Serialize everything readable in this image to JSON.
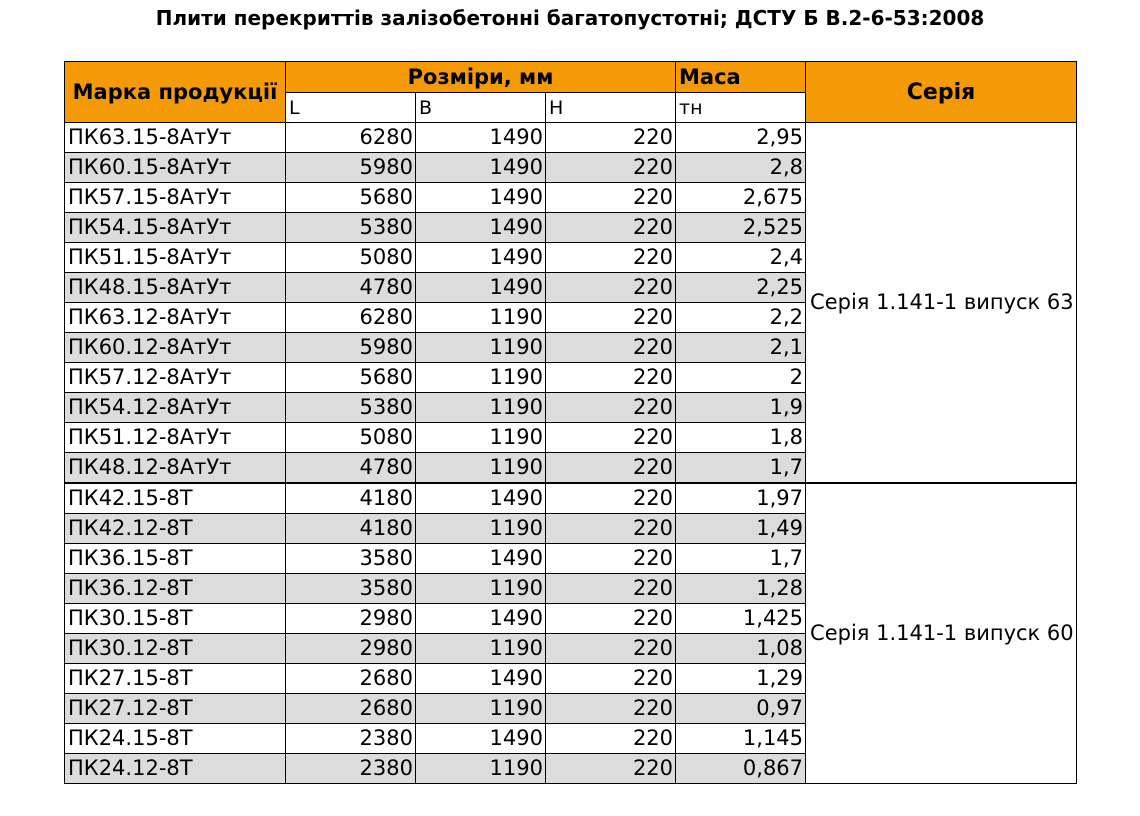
{
  "title": "Плити перекриттів залізобетонні багатопустотні; ДСТУ Б В.2-6-53:2008",
  "headers": {
    "mark": "Марка продукції",
    "sizes": "Розміри, мм",
    "mass": "Маса",
    "series": "Серія",
    "L": "L",
    "B": "B",
    "H": "H",
    "mass_unit": "тн"
  },
  "groups": [
    {
      "series": "Серія 1.141-1 випуск 63",
      "rows": [
        {
          "mark": "ПК63.15-8АтУт",
          "L": "6280",
          "B": "1490",
          "H": "220",
          "mass": "2,95"
        },
        {
          "mark": "ПК60.15-8АтУт",
          "L": "5980",
          "B": "1490",
          "H": "220",
          "mass": "2,8"
        },
        {
          "mark": "ПК57.15-8АтУт",
          "L": "5680",
          "B": "1490",
          "H": "220",
          "mass": "2,675"
        },
        {
          "mark": "ПК54.15-8АтУт",
          "L": "5380",
          "B": "1490",
          "H": "220",
          "mass": "2,525"
        },
        {
          "mark": "ПК51.15-8АтУт",
          "L": "5080",
          "B": "1490",
          "H": "220",
          "mass": "2,4"
        },
        {
          "mark": "ПК48.15-8АтУт",
          "L": "4780",
          "B": "1490",
          "H": "220",
          "mass": "2,25"
        },
        {
          "mark": "ПК63.12-8АтУт",
          "L": "6280",
          "B": "1190",
          "H": "220",
          "mass": "2,2"
        },
        {
          "mark": "ПК60.12-8АтУт",
          "L": "5980",
          "B": "1190",
          "H": "220",
          "mass": "2,1"
        },
        {
          "mark": "ПК57.12-8АтУт",
          "L": "5680",
          "B": "1190",
          "H": "220",
          "mass": "2"
        },
        {
          "mark": "ПК54.12-8АтУт",
          "L": "5380",
          "B": "1190",
          "H": "220",
          "mass": "1,9"
        },
        {
          "mark": "ПК51.12-8АтУт",
          "L": "5080",
          "B": "1190",
          "H": "220",
          "mass": "1,8"
        },
        {
          "mark": "ПК48.12-8АтУт",
          "L": "4780",
          "B": "1190",
          "H": "220",
          "mass": "1,7"
        }
      ]
    },
    {
      "series": "Серія 1.141-1 випуск 60",
      "rows": [
        {
          "mark": "ПК42.15-8Т",
          "L": "4180",
          "B": "1490",
          "H": "220",
          "mass": "1,97"
        },
        {
          "mark": "ПК42.12-8Т",
          "L": "4180",
          "B": "1190",
          "H": "220",
          "mass": "1,49"
        },
        {
          "mark": "ПК36.15-8Т",
          "L": "3580",
          "B": "1490",
          "H": "220",
          "mass": "1,7"
        },
        {
          "mark": "ПК36.12-8Т",
          "L": "3580",
          "B": "1190",
          "H": "220",
          "mass": "1,28"
        },
        {
          "mark": "ПК30.15-8Т",
          "L": "2980",
          "B": "1490",
          "H": "220",
          "mass": "1,425"
        },
        {
          "mark": "ПК30.12-8Т",
          "L": "2980",
          "B": "1190",
          "H": "220",
          "mass": "1,08"
        },
        {
          "mark": "ПК27.15-8Т",
          "L": "2680",
          "B": "1490",
          "H": "220",
          "mass": "1,29"
        },
        {
          "mark": "ПК27.12-8Т",
          "L": "2680",
          "B": "1190",
          "H": "220",
          "mass": "0,97"
        },
        {
          "mark": "ПК24.15-8Т",
          "L": "2380",
          "B": "1490",
          "H": "220",
          "mass": "1,145"
        },
        {
          "mark": "ПК24.12-8Т",
          "L": "2380",
          "B": "1190",
          "H": "220",
          "mass": "0,867"
        }
      ]
    }
  ],
  "colors": {
    "header_bg": "#f39a06",
    "alt_row_bg": "#dcdcdc"
  }
}
